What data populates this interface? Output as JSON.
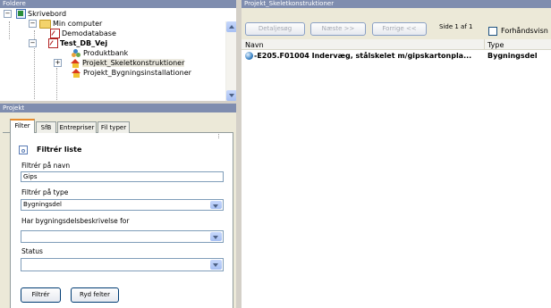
{
  "left_top": {
    "header": "Foldere",
    "tree": [
      {
        "label": "Skrivebord",
        "icon": "desktop-icon"
      },
      {
        "label": "Min computer",
        "icon": "folder-icon"
      },
      {
        "label": "Demodatabase",
        "icon": "database-icon"
      },
      {
        "label": "Test_DB_Vej",
        "icon": "database-icon"
      },
      {
        "label": "Produktbank",
        "icon": "product-bank-icon"
      },
      {
        "label": "Projekt_Skeletkonstruktioner",
        "icon": "project-icon"
      },
      {
        "label": "Projekt_Bygningsinstallationer",
        "icon": "project-icon"
      }
    ]
  },
  "left_bottom": {
    "header": "Projekt",
    "tabs": [
      "Filter",
      "SfB",
      "Entrepriser",
      "Fil typer"
    ],
    "filter_title": "Filtrér liste",
    "name_label": "Filtrér på navn",
    "name_value": "Gips",
    "type_label": "Filtrér på type",
    "type_value": "Bygningsdel",
    "desc_label": "Har bygningsdelsbeskrivelse for",
    "desc_value": "",
    "status_label": "Status",
    "status_value": "",
    "filter_button": "Filtrér",
    "clear_button": "Ryd felter"
  },
  "right": {
    "header": "Projekt_Skeletkonstruktioner",
    "toolbar": {
      "details": "Detaljesøg",
      "next": "Næste >>",
      "prev": "Forrige <<",
      "page_info": "Side 1 af 1",
      "preview": "Forhåndsvisn"
    },
    "columns": [
      "Navn",
      "Type"
    ],
    "rows": [
      {
        "name": "-E205.F01004 Indervæg, stålskelet m/gipskartonpla...",
        "type": "Bygningsdel"
      }
    ]
  }
}
